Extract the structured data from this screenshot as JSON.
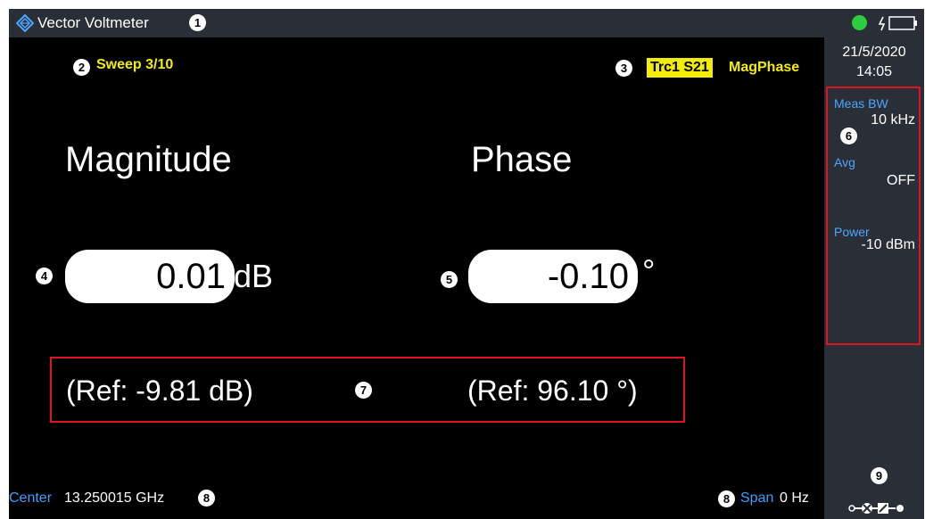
{
  "window": {
    "title": "Vector Voltmeter"
  },
  "callouts": {
    "c1": "1",
    "c2": "2",
    "c3": "3",
    "c4": "4",
    "c5": "5",
    "c6": "6",
    "c7": "7",
    "c8": "8",
    "c9": "9"
  },
  "header": {
    "sweep": "Sweep 3/10",
    "trace_tag": "Trc1  S21",
    "trace_format": "MagPhase"
  },
  "magnitude": {
    "heading": "Magnitude",
    "value": "0.01",
    "unit": "dB",
    "ref": "(Ref: -9.81  dB)"
  },
  "phase": {
    "heading": "Phase",
    "value": "-0.10",
    "unit": "°",
    "ref": "(Ref: 96.10  °)"
  },
  "sidebar": {
    "date": "21/5/2020",
    "time": "14:05",
    "meas_bw_label": "Meas BW",
    "meas_bw_value": "10 kHz",
    "avg_label": "Avg",
    "avg_value": "OFF",
    "power_label": "Power",
    "power_value": "-10 dBm"
  },
  "footer": {
    "center_label": "Center",
    "center_value": "13.250015 GHz",
    "span_label": "Span",
    "span_value": "0 Hz"
  },
  "icons": {
    "logo": "rs-diamond-logo-icon",
    "status": "status-led-icon",
    "battery": "battery-charging-icon",
    "connector": "calibration-connector-icon"
  },
  "colors": {
    "accent_yellow": "#f3ee00",
    "label_blue": "#3aa0ff",
    "highlight_red": "#e0141e",
    "status_green": "#2ecc40",
    "panel_gray": "#2a2e36"
  }
}
